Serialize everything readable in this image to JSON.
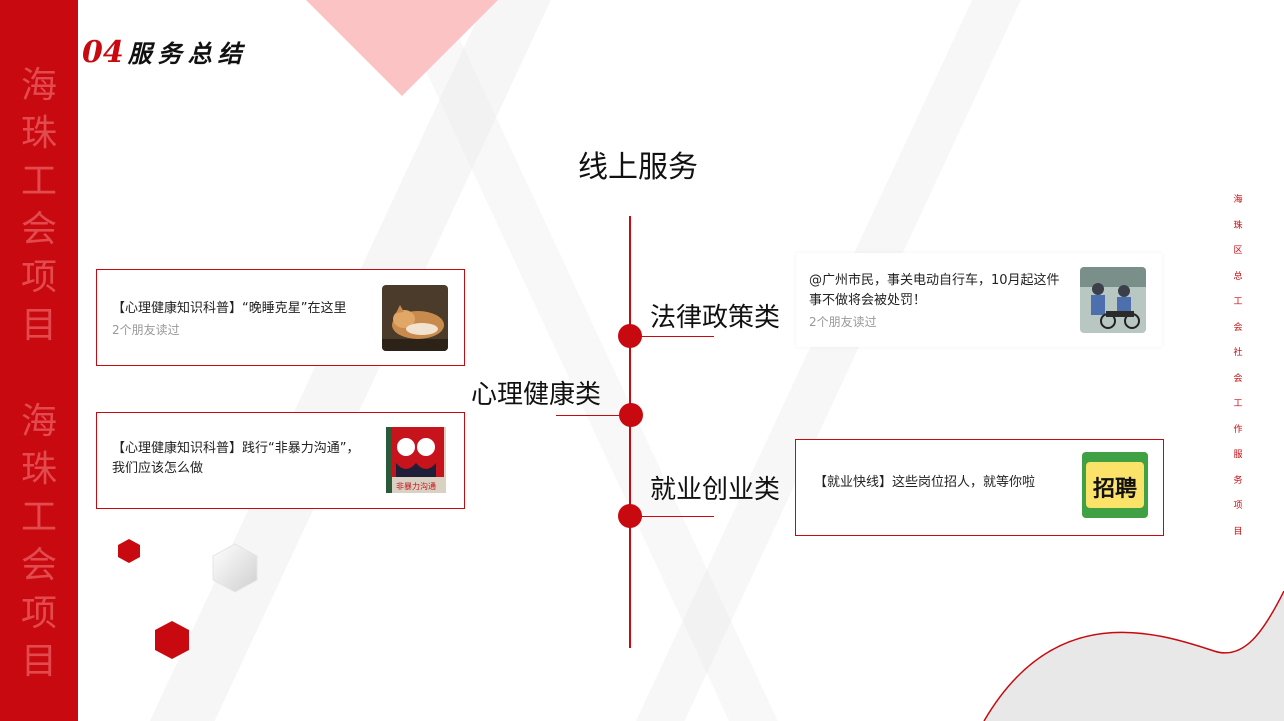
{
  "heading": {
    "number": "04",
    "text": "服务总结"
  },
  "side_band_text": [
    "海",
    "珠",
    "工",
    "会",
    "项",
    "目",
    "海",
    "珠",
    "工",
    "会",
    "项",
    "目"
  ],
  "right_vertical_text": [
    "海",
    "珠",
    "区",
    "总",
    "工",
    "会",
    "社",
    "会",
    "工",
    "作",
    "服",
    "务",
    "项",
    "目"
  ],
  "main_title": "线上服务",
  "categories": {
    "law": "法律政策类",
    "mental": "心理健康类",
    "employment": "就业创业类"
  },
  "cards": {
    "mental1": {
      "title": "【心理健康知识科普】“晚睡克星”在这里",
      "meta": "2个朋友读过"
    },
    "mental2": {
      "title": "【心理健康知识科普】践行“非暴力沟通”，我们应该怎么做"
    },
    "law1": {
      "title": "@广州市民，事关电动自行车，10月起这件事不做将会被处罚！",
      "meta": "2个朋友读过"
    },
    "job1": {
      "title": "【就业快线】这些岗位招人，就等你啦"
    }
  },
  "thumb_texts": {
    "book": "非暴力沟通",
    "hire": "招聘"
  },
  "colors": {
    "accent": "#c8090f",
    "pink": "#fbc3c3"
  }
}
